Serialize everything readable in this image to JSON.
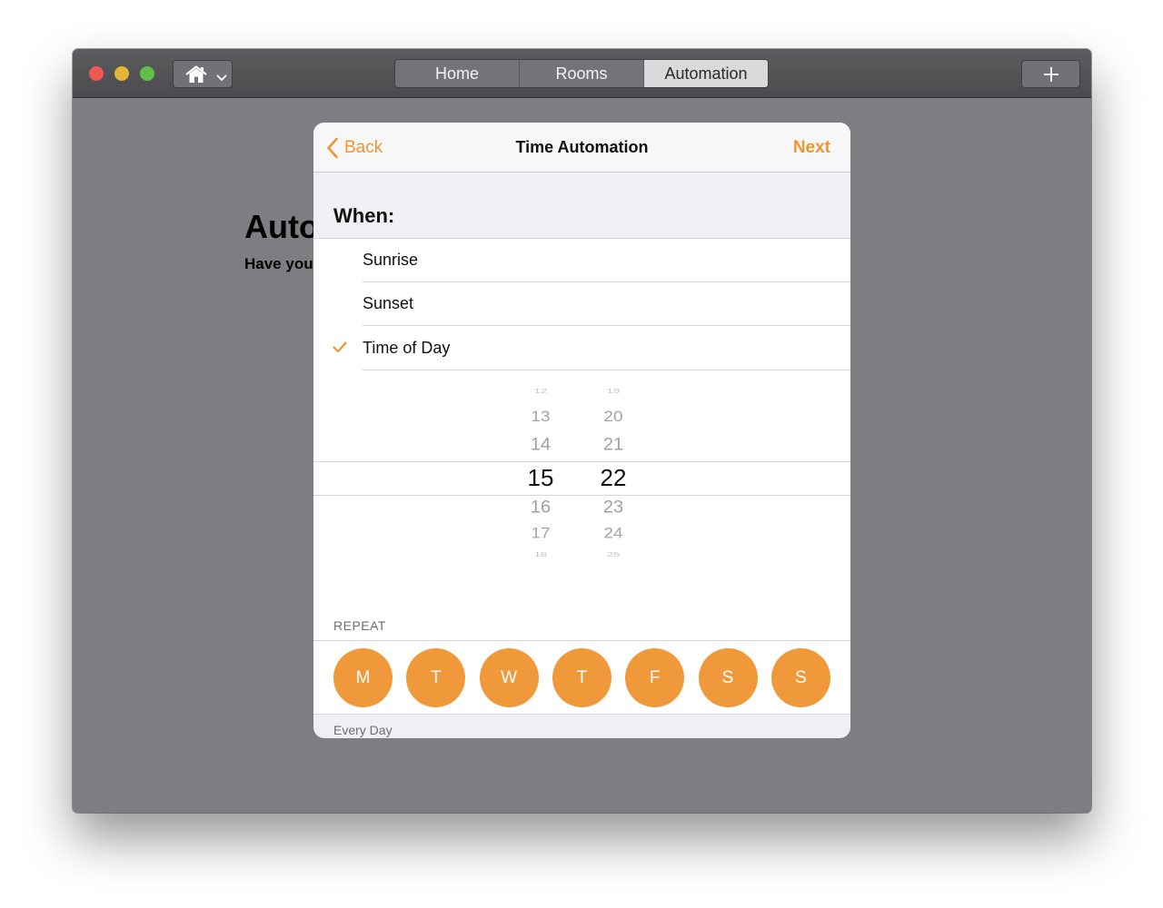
{
  "window": {
    "tabs": [
      {
        "label": "Home",
        "active": false
      },
      {
        "label": "Rooms",
        "active": false
      },
      {
        "label": "Automation",
        "active": true
      }
    ],
    "home_menu_icon": "house-icon",
    "add_button_icon": "plus-icon"
  },
  "background": {
    "title": "Auto",
    "subtitle": "Have you"
  },
  "sheet": {
    "back_label": "Back",
    "title": "Time Automation",
    "next_label": "Next",
    "when_label": "When:",
    "options": [
      {
        "label": "Sunrise",
        "selected": false
      },
      {
        "label": "Sunset",
        "selected": false
      },
      {
        "label": "Time of Day",
        "selected": true
      }
    ],
    "picker": {
      "hour_values": [
        "12",
        "13",
        "14",
        "15",
        "16",
        "17",
        "18"
      ],
      "minute_values": [
        "19",
        "20",
        "21",
        "22",
        "23",
        "24",
        "25"
      ],
      "selected_hour": "15",
      "selected_minute": "22"
    },
    "repeat_label": "REPEAT",
    "days": [
      "M",
      "T",
      "W",
      "T",
      "F",
      "S",
      "S"
    ],
    "repeat_summary": "Every Day"
  },
  "colors": {
    "accent": "#f0952f",
    "day_fill": "#f0993a",
    "window_bg": "#7e7e82"
  }
}
